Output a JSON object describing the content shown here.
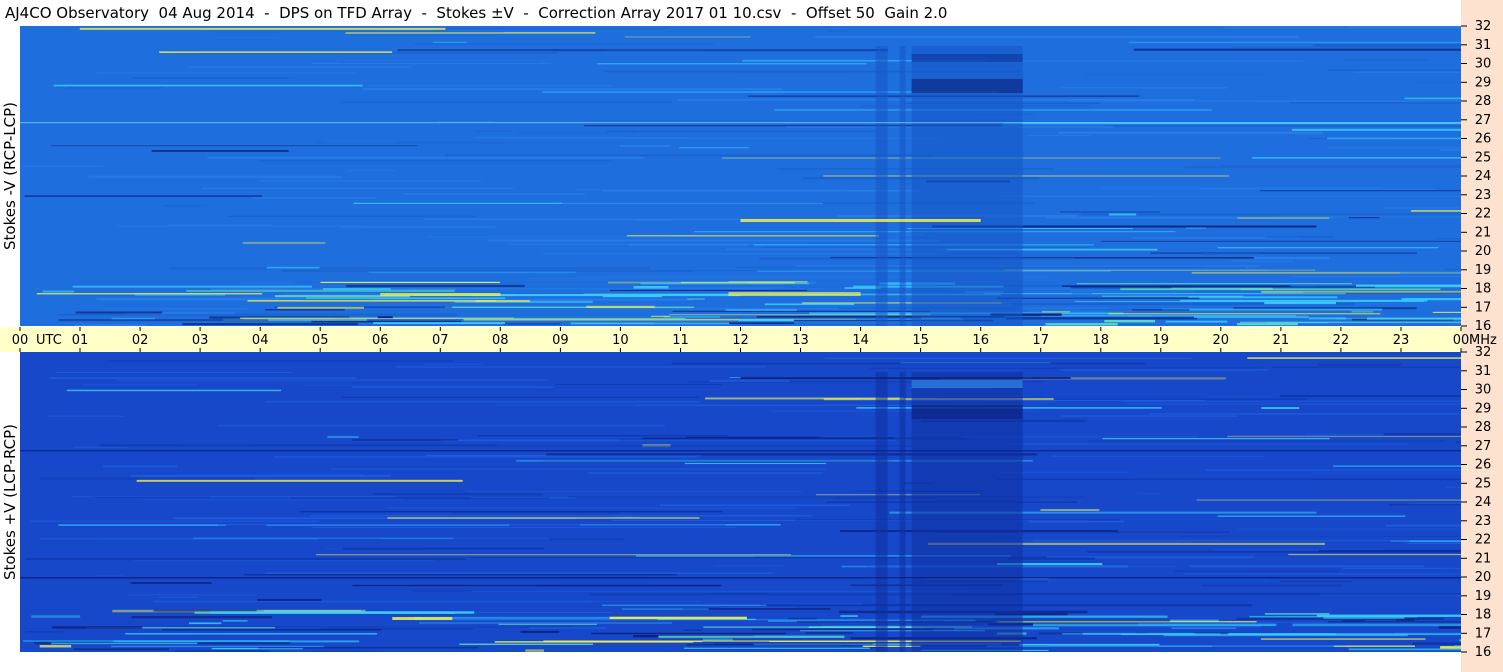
{
  "title": "AJ4CO Observatory  04 Aug 2014  -  DPS on TFD Array  -  Stokes ±V  -  Correction Array 2017 01 10.csv  -  Offset 50  Gain 2.0",
  "panels": {
    "top": {
      "ylabel": "Stokes -V (RCP-LCP)"
    },
    "bottom": {
      "ylabel": "Stokes +V (LCP-RCP)"
    }
  },
  "time_axis": {
    "labels": [
      "00",
      "01",
      "02",
      "03",
      "04",
      "05",
      "06",
      "07",
      "08",
      "09",
      "10",
      "11",
      "12",
      "13",
      "14",
      "15",
      "16",
      "17",
      "18",
      "19",
      "20",
      "21",
      "22",
      "23",
      "00"
    ],
    "utc_label": "UTC",
    "freq_unit": "MHz"
  },
  "colors": {
    "title_bg": "#ffffff",
    "axis_strip": "#fde3cf",
    "time_strip": "#ffffc8",
    "top_panel_base": "#1e6fdd",
    "bottom_panel_base": "#1648c9",
    "burst_cyan": "#39d0ff",
    "burst_yellow": "#f2f04a",
    "dark_band": "#0a1f7a"
  },
  "chart_data": [
    {
      "type": "heatmap",
      "title": "Stokes -V (RCP-LCP)",
      "xlabel": "UTC",
      "ylabel": "Stokes -V (RCP-LCP)",
      "x_ticks": [
        "00",
        "01",
        "02",
        "03",
        "04",
        "05",
        "06",
        "07",
        "08",
        "09",
        "10",
        "11",
        "12",
        "13",
        "14",
        "15",
        "16",
        "17",
        "18",
        "19",
        "20",
        "21",
        "22",
        "23",
        "00"
      ],
      "xlim": [
        0,
        24
      ],
      "ylim": [
        16,
        32
      ],
      "y_unit": "MHz",
      "y_ticks": [
        16,
        17,
        18,
        19,
        20,
        21,
        22,
        23,
        24,
        25,
        26,
        27,
        28,
        29,
        30,
        31,
        32
      ]
    },
    {
      "type": "heatmap",
      "title": "Stokes +V (LCP-RCP)",
      "xlabel": "UTC",
      "ylabel": "Stokes +V (LCP-RCP)",
      "x_ticks": [
        "00",
        "01",
        "02",
        "03",
        "04",
        "05",
        "06",
        "07",
        "08",
        "09",
        "10",
        "11",
        "12",
        "13",
        "14",
        "15",
        "16",
        "17",
        "18",
        "19",
        "20",
        "21",
        "22",
        "23",
        "00"
      ],
      "xlim": [
        0,
        24
      ],
      "ylim": [
        16,
        32
      ],
      "y_unit": "MHz",
      "y_ticks": [
        16,
        17,
        18,
        19,
        20,
        21,
        22,
        23,
        24,
        25,
        26,
        27,
        28,
        29,
        30,
        31,
        32
      ]
    }
  ]
}
